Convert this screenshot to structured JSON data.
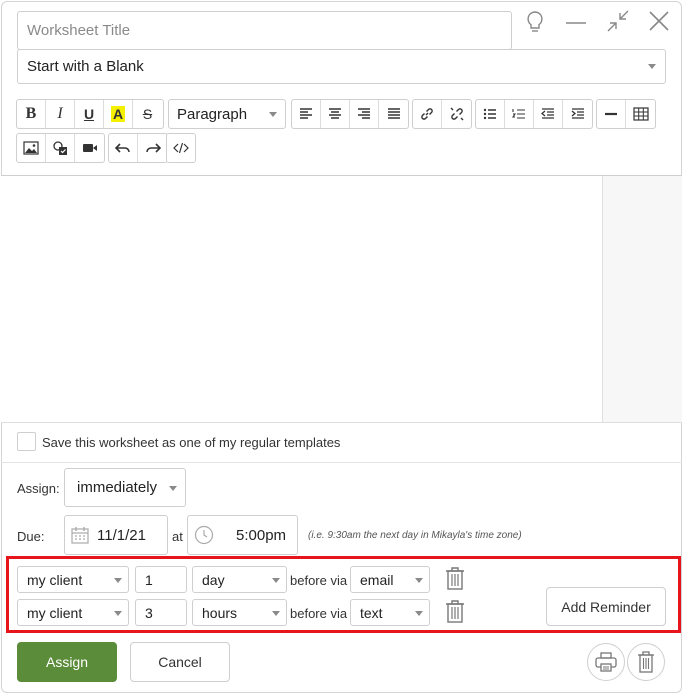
{
  "window": {
    "title_placeholder": "Worksheet Title",
    "template_select": "Start with a Blank"
  },
  "toolbar": {
    "bold": "B",
    "italic": "I",
    "underline": "U",
    "highlight": "A",
    "strike": "S",
    "format_select": "Paragraph"
  },
  "save_template_label": "Save this worksheet as one of my regular templates",
  "assign": {
    "label": "Assign:",
    "value": "immediately"
  },
  "due": {
    "label": "Due:",
    "date": "11/1/21",
    "at_label": "at",
    "time": "5:00pm",
    "hint": "(i.e. 9:30am the next day in Mikayla's time zone)"
  },
  "reminders": [
    {
      "recipient": "my client",
      "amount": "1",
      "unit": "day",
      "before_via": "before via",
      "channel": "email"
    },
    {
      "recipient": "my client",
      "amount": "3",
      "unit": "hours",
      "before_via": "before via",
      "channel": "text"
    }
  ],
  "add_reminder_label": "Add Reminder",
  "footer": {
    "assign_label": "Assign",
    "cancel_label": "Cancel"
  },
  "colors": {
    "highlight_box": "#e8141b",
    "assign_button": "#5b8c3a",
    "highlight_yellow": "#f4f000"
  }
}
